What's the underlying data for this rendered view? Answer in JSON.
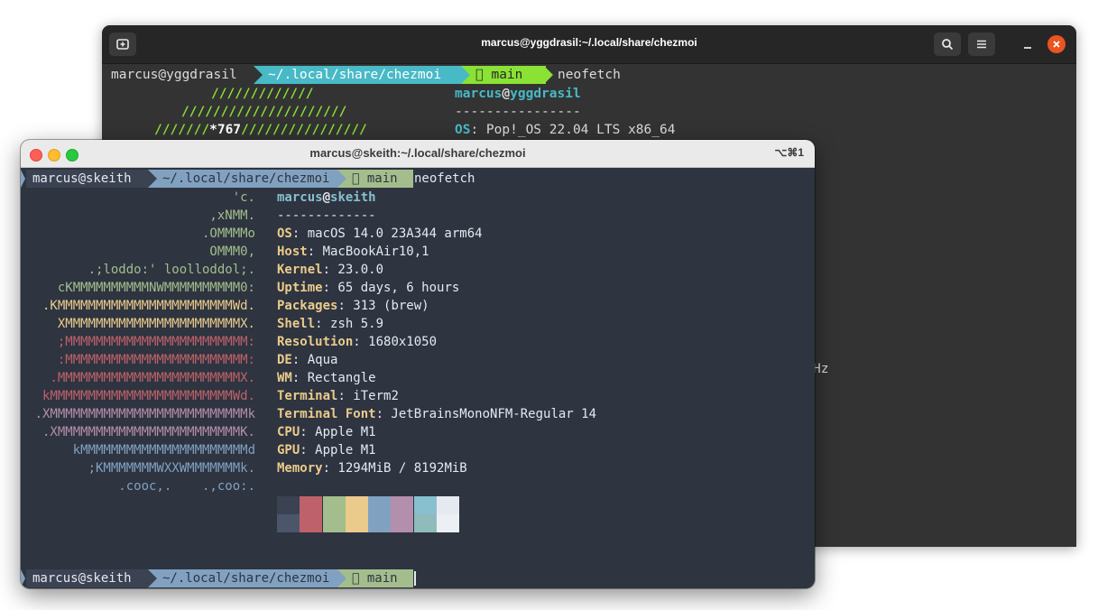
{
  "back_window": {
    "title": "marcus@yggdrasil:~/.local/share/chezmoi",
    "prompt": {
      "user": "marcus@yggdrasil",
      "path": "~/.local/share/chezmoi",
      "branch": " main",
      "command": "neofetch"
    },
    "ascii": [
      "/////////////",
      "/////////////////////",
      "///////",
      "*767",
      "////////////////"
    ],
    "info": {
      "user": "marcus",
      "at": "@",
      "host": "yggdrasil",
      "separator": "----------------",
      "os_key": "OS",
      "os_value": ": Pop!_OS 22.04 LTS x86_64"
    },
    "hidden_fragment": "Hz",
    "colors": {
      "bg": "#333333",
      "titlebar": "#262626",
      "accent_close": "#e95420",
      "teal": "#48b9c7",
      "green": "#8ae234"
    }
  },
  "front_window": {
    "title": "marcus@skeith:~/.local/share/chezmoi",
    "shortcut": "⌥⌘1",
    "prompt": {
      "user": "marcus@skeith",
      "path": "~/.local/share/chezmoi",
      "branch": " main",
      "command": "neofetch"
    },
    "ascii": [
      {
        "text": "'c.",
        "color": "#a3be8c"
      },
      {
        "text": ",xNMM.",
        "color": "#a3be8c"
      },
      {
        "text": ".OMMMMo",
        "color": "#a3be8c"
      },
      {
        "text": "OMMM0,",
        "color": "#a3be8c"
      },
      {
        "text": ".;loddo:' loolloddol;.",
        "color": "#a3be8c"
      },
      {
        "text": "cKMMMMMMMMMMNWMMMMMMMMMM0:",
        "color": "#a3be8c"
      },
      {
        "text": ".KMMMMMMMMMMMMMMMMMMMMMMMWd.",
        "color": "#ebcb8b"
      },
      {
        "text": "XMMMMMMMMMMMMMMMMMMMMMMMX.",
        "color": "#ebcb8b"
      },
      {
        "text": ";MMMMMMMMMMMMMMMMMMMMMMMM:",
        "color": "#bf616a"
      },
      {
        "text": ":MMMMMMMMMMMMMMMMMMMMMMMM:",
        "color": "#bf616a"
      },
      {
        "text": ".MMMMMMMMMMMMMMMMMMMMMMMMX.",
        "color": "#bf616a"
      },
      {
        "text": "kMMMMMMMMMMMMMMMMMMMMMMMMWd.",
        "color": "#bf616a"
      },
      {
        "text": ".XMMMMMMMMMMMMMMMMMMMMMMMMMMk",
        "color": "#b48ead"
      },
      {
        "text": ".XMMMMMMMMMMMMMMMMMMMMMMMMK.",
        "color": "#b48ead"
      },
      {
        "text": "kMMMMMMMMMMMMMMMMMMMMMMd",
        "color": "#81a1c1"
      },
      {
        "text": ";KMMMMMMMWXXWMMMMMMMk.",
        "color": "#81a1c1"
      },
      {
        "text": ".cooc,.    .,coo:.",
        "color": "#81a1c1"
      }
    ],
    "info_user": "marcus",
    "info_at": "@",
    "info_host": "skeith",
    "info_separator": "-------------",
    "info": [
      {
        "key": "OS",
        "value": ": macOS 14.0 23A344 arm64"
      },
      {
        "key": "Host",
        "value": ": MacBookAir10,1"
      },
      {
        "key": "Kernel",
        "value": ": 23.0.0"
      },
      {
        "key": "Uptime",
        "value": ": 65 days, 6 hours"
      },
      {
        "key": "Packages",
        "value": ": 313 (brew)"
      },
      {
        "key": "Shell",
        "value": ": zsh 5.9"
      },
      {
        "key": "Resolution",
        "value": ": 1680x1050"
      },
      {
        "key": "DE",
        "value": ": Aqua"
      },
      {
        "key": "WM",
        "value": ": Rectangle"
      },
      {
        "key": "Terminal",
        "value": ": iTerm2"
      },
      {
        "key": "Terminal Font",
        "value": ": JetBrainsMonoNFM-Regular 14"
      },
      {
        "key": "CPU",
        "value": ": Apple M1"
      },
      {
        "key": "GPU",
        "value": ": Apple M1"
      },
      {
        "key": "Memory",
        "value": ": 1294MiB / 8192MiB"
      }
    ],
    "palette_top": [
      "#3b4252",
      "#bf616a",
      "#a3be8c",
      "#ebcb8b",
      "#81a1c1",
      "#b48ead",
      "#88c0d0",
      "#e5e9f0"
    ],
    "palette_bottom": [
      "#4c566a",
      "#bf616a",
      "#a3be8c",
      "#ebcb8b",
      "#81a1c1",
      "#b48ead",
      "#8fbcbb",
      "#eceff4"
    ],
    "colors": {
      "bg": "#2e3440",
      "seg_user": "#3b4252",
      "seg_path": "#81a1c1",
      "seg_branch": "#a3be8c",
      "fg": "#e5e9f0",
      "info_user": "#88c0d0"
    }
  }
}
